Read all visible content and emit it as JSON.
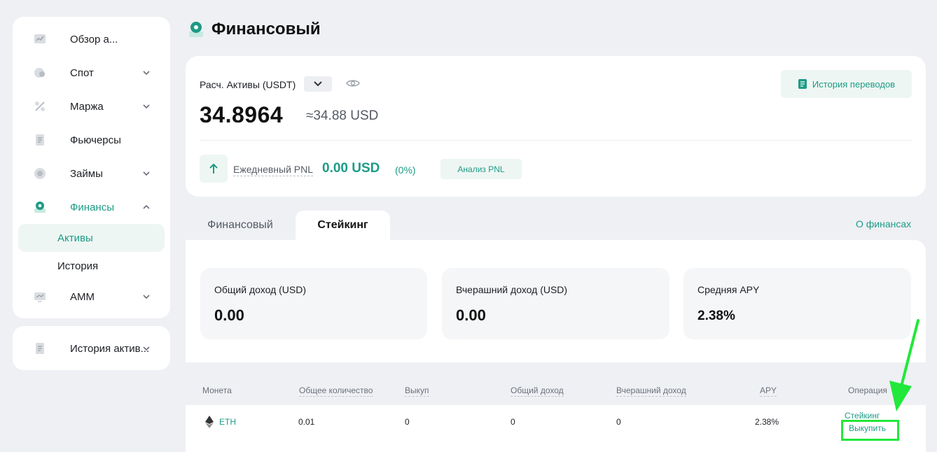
{
  "sidebar": {
    "items": [
      {
        "label": "Обзор а...",
        "icon": "overview-icon"
      },
      {
        "label": "Спот",
        "icon": "spot-icon"
      },
      {
        "label": "Маржа",
        "icon": "margin-icon"
      },
      {
        "label": "Фьючерсы",
        "icon": "futures-icon"
      },
      {
        "label": "Займы",
        "icon": "loans-icon"
      },
      {
        "label": "Финансы",
        "icon": "finance-icon"
      },
      {
        "label": "AMM",
        "icon": "amm-icon"
      }
    ],
    "sub_items": [
      {
        "label": "Активы"
      },
      {
        "label": "История"
      }
    ],
    "history_card": {
      "label": "История актив..."
    }
  },
  "header": {
    "title": "Финансовый"
  },
  "summary": {
    "est_label": "Расч. Активы (USDT)",
    "value": "34.8964",
    "approx": "≈34.88 USD",
    "history_button": "История переводов",
    "pnl_label": "Ежедневный PNL",
    "pnl_value": "0.00 USD",
    "pnl_pct": "(0%)",
    "pnl_analysis_button": "Анализ PNL"
  },
  "tabs": [
    {
      "label": "Финансовый",
      "active": false
    },
    {
      "label": "Стейкинг",
      "active": true
    }
  ],
  "about_link": "О финансах",
  "stats": [
    {
      "label": "Общий доход (USD)",
      "value": "0.00"
    },
    {
      "label": "Вчерашний доход (USD)",
      "value": "0.00"
    },
    {
      "label": "Средняя APY",
      "value": "2.38%"
    }
  ],
  "table": {
    "headers": [
      "Монета",
      "Общее количество",
      "Выкуп",
      "Общий доход",
      "Вчерашний доход",
      "APY",
      "Операция"
    ],
    "rows": [
      {
        "coin": "ETH",
        "total": "0.01",
        "redeem": "0",
        "total_income": "0",
        "yesterday_income": "0",
        "apy": "2.38%",
        "op_stake": "Стейкинг",
        "op_redeem": "Выкупить"
      }
    ]
  },
  "colors": {
    "accent": "#1d9b86",
    "highlight": "#22e83b",
    "background": "#eef0f4"
  }
}
